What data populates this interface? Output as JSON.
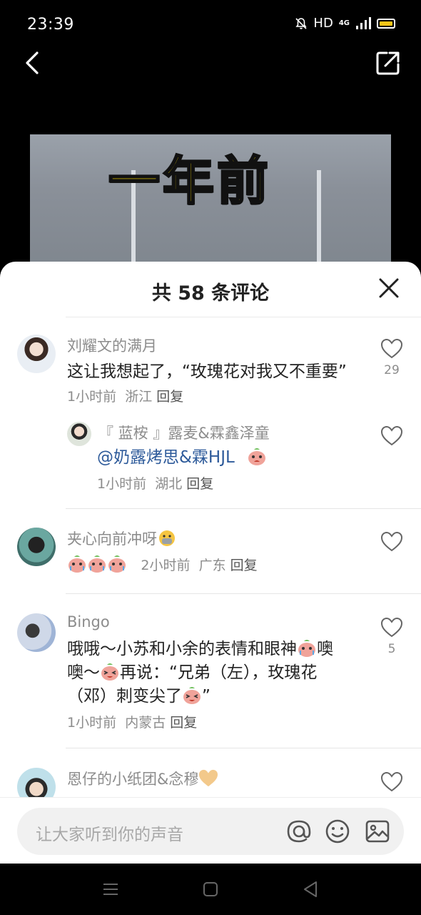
{
  "status_bar": {
    "time": "23:39",
    "hd": "HD",
    "network": "4G"
  },
  "video": {
    "caption": "一年前"
  },
  "sheet": {
    "title": "共 58 条评论"
  },
  "comments": [
    {
      "username": "刘耀文的满月",
      "text": "这让我想起了，“玫瑰花对我又不重要”",
      "time": "1小时前",
      "location": "浙江",
      "reply": "回复",
      "likes": "29",
      "reply_item": {
        "username": "『 蓝桉 』露麦&霖鑫泽童",
        "text": "@奶露烤思&霖HJL",
        "time": "1小时前",
        "location": "湖北",
        "reply": "回复"
      }
    },
    {
      "username": "夹心向前冲呀",
      "time": "2小时前",
      "location": "广东",
      "reply": "回复"
    },
    {
      "username": "Bingo",
      "text_1": "哦哦～小苏和小余的表情和眼神",
      "text_2": "噢",
      "text_3": "噢～",
      "text_4": "再说：“兄弟（左），玫瑰花",
      "text_5": "（邓）刺变尖了",
      "text_6": "”",
      "time": "1小时前",
      "location": "内蒙古",
      "reply": "回复",
      "likes": "5"
    },
    {
      "username": "恩仔的小纸团&念穆"
    }
  ],
  "input": {
    "placeholder": "让大家听到你的声音"
  },
  "icons": {
    "back": "back-arrow-icon",
    "share": "share-icon",
    "close": "close-icon",
    "like": "heart-icon",
    "mention": "at-icon",
    "emoji": "smile-icon",
    "image": "image-icon"
  },
  "colors": {
    "accent_mention": "#2d5a9a",
    "battery": "#f5c518",
    "caption": "#ffe000"
  }
}
